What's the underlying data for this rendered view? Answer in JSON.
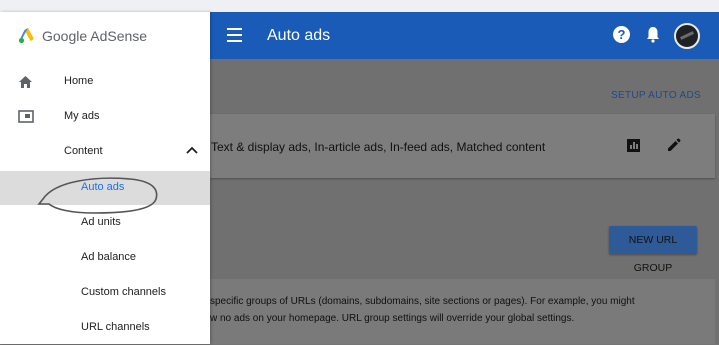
{
  "brand": {
    "name": "Google AdSense"
  },
  "appbar": {
    "title": "Auto ads"
  },
  "sidebar": {
    "items": [
      {
        "label": "Home"
      },
      {
        "label": "My ads"
      },
      {
        "label": "Content"
      },
      {
        "label": "Auto ads"
      },
      {
        "label": "Ad units"
      },
      {
        "label": "Ad balance"
      },
      {
        "label": "Custom channels"
      },
      {
        "label": "URL channels"
      }
    ]
  },
  "main": {
    "setup_link": "SETUP AUTO ADS",
    "ad_types": "Text & display ads, In-article ads, In-feed ads, Matched content",
    "new_url_group": "NEW URL GROUP",
    "info_line1": "specific groups of URLs (domains, subdomains, site sections or pages). For example, you might",
    "info_line2": "w no ads on your homepage. URL group settings will override your global settings."
  },
  "colors": {
    "appbar": "#1a5bb8",
    "active_text": "#1a73e8",
    "active_bg": "#dcdcdc"
  }
}
